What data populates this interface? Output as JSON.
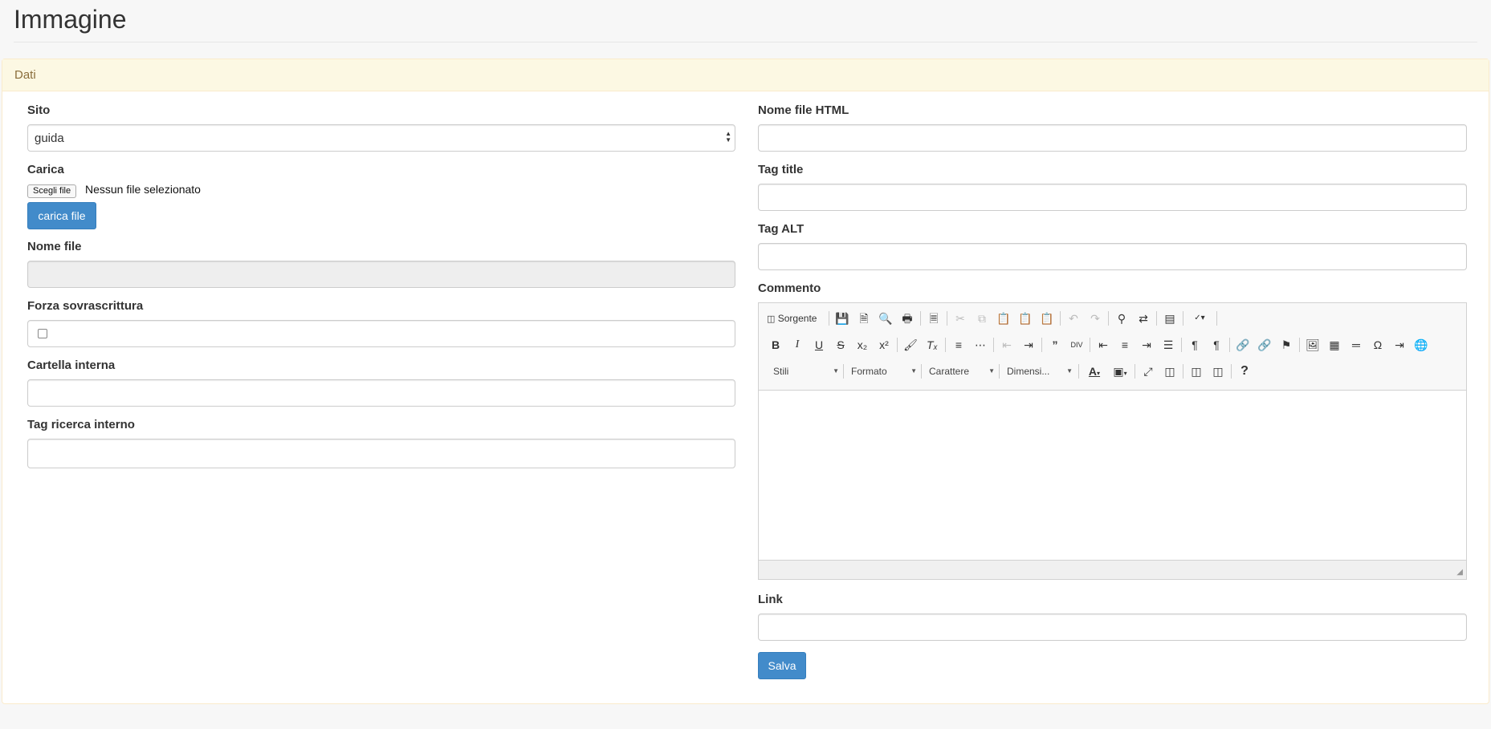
{
  "page": {
    "title": "Immagine"
  },
  "panel": {
    "heading": "Dati"
  },
  "left": {
    "sito": {
      "label": "Sito",
      "value": "guida"
    },
    "carica": {
      "label": "Carica",
      "file_button": "Scegli file",
      "file_status": "Nessun file selezionato",
      "upload_button": "carica file"
    },
    "nome_file": {
      "label": "Nome file",
      "value": ""
    },
    "forza": {
      "label": "Forza sovrascrittura"
    },
    "cartella": {
      "label": "Cartella interna",
      "value": ""
    },
    "tag_ricerca": {
      "label": "Tag ricerca interno",
      "value": ""
    }
  },
  "right": {
    "nome_html": {
      "label": "Nome file HTML",
      "value": ""
    },
    "tag_title": {
      "label": "Tag title",
      "value": ""
    },
    "tag_alt": {
      "label": "Tag ALT",
      "value": ""
    },
    "commento": {
      "label": "Commento",
      "source_label": "Sorgente",
      "combos": {
        "stili": "Stili",
        "formato": "Formato",
        "carattere": "Carattere",
        "dimensione": "Dimensi..."
      }
    },
    "link": {
      "label": "Link",
      "value": ""
    },
    "save_button": "Salva"
  },
  "colors": {
    "primary": "#428bca",
    "panel_heading_bg": "#fcf8e3",
    "panel_border": "#faebcc"
  }
}
